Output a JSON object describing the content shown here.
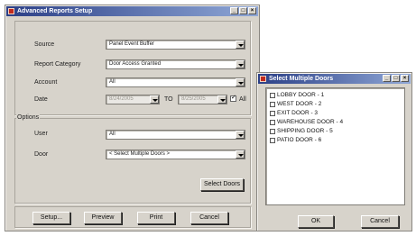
{
  "report_window": {
    "title": "Advanced Reports Setup",
    "fields": {
      "source_label": "Source",
      "source_value": "Panel Event Buffer",
      "report_category_label": "Report Category",
      "report_category_value": "Door Access Granted",
      "account_label": "Account",
      "account_value": "All",
      "date_label": "Date",
      "date_from": "8/24/2005",
      "date_to_label": "TO",
      "date_to": "8/25/2005",
      "all_label": "All",
      "all_checked": true
    },
    "options": {
      "group_label": "Options",
      "user_label": "User",
      "user_value": "All",
      "door_label": "Door",
      "door_value": "< Select Multiple Doors >",
      "select_doors_button": "Select Doors"
    },
    "buttons": {
      "setup": "Setup...",
      "preview": "Preview",
      "print": "Print",
      "cancel": "Cancel"
    }
  },
  "doors_window": {
    "title": "Select Multiple Doors",
    "items": [
      "LOBBY DOOR - 1",
      "WEST DOOR - 2",
      "EXIT DOOR - 3",
      "WAREHOUSE DOOR - 4",
      "SHIPPING DOOR - 5",
      "PATIO DOOR - 6"
    ],
    "ok_button": "OK",
    "cancel_button": "Cancel"
  },
  "titlebar_buttons": {
    "minimize": "_",
    "maximize": "□",
    "close": "×"
  },
  "colors": {
    "titlebar_start": "#2b3f86",
    "titlebar_end": "#8fa7d6",
    "window_face": "#d7d3cb",
    "app_icon": "#c02a1e"
  },
  "icons": [
    "app-icon",
    "dropdown-arrow-icon",
    "checkbox-icon"
  ]
}
